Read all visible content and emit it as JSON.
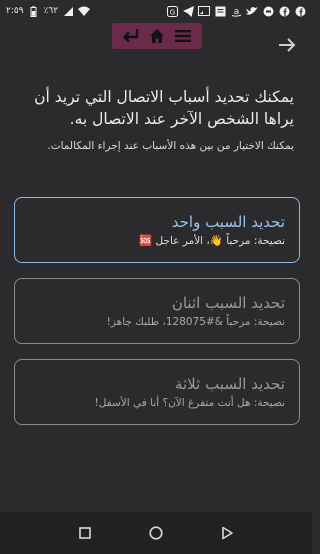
{
  "status_bar": {
    "time": "٢:٥٩",
    "battery": "٪٦٢",
    "icons_left": [
      "battery-icon",
      "signal-icon",
      "wifi-icon"
    ],
    "icons_right": [
      "app-icon",
      "telegram-icon",
      "cast-icon",
      "messages-icon",
      "amazon-icon",
      "twitter-icon",
      "game-icon",
      "facebook-icon",
      "facebook-icon"
    ]
  },
  "nav_pill": {
    "icons": [
      "back-return-icon",
      "home-icon",
      "menu-icon"
    ]
  },
  "heading": "يمكنك تحديد أسباب الاتصال التي تريد أن يراها الشخص الآخر عند الاتصال به.",
  "subheading": "يمكنك الاختيار من بين هذه الأسباب عند إجراء المكالمات.",
  "cards": [
    {
      "title": "تحديد السبب واحد",
      "tip": "نصيحة: مرحباً 👋، الأمر عاجل 🆘"
    },
    {
      "title": "تحديد السبب اثنان",
      "tip": "نصيحة: مرحباً &#128075، طلبك جاهز!"
    },
    {
      "title": "تحديد السبب ثلاثة",
      "tip": "نصيحة: هل أنت متفرغ الآن؟ أنا في الأسفل!"
    }
  ],
  "colors": {
    "background": "#2b2b2e",
    "accent": "#8ab8e6",
    "nav_pill": "#6b2a4a"
  }
}
